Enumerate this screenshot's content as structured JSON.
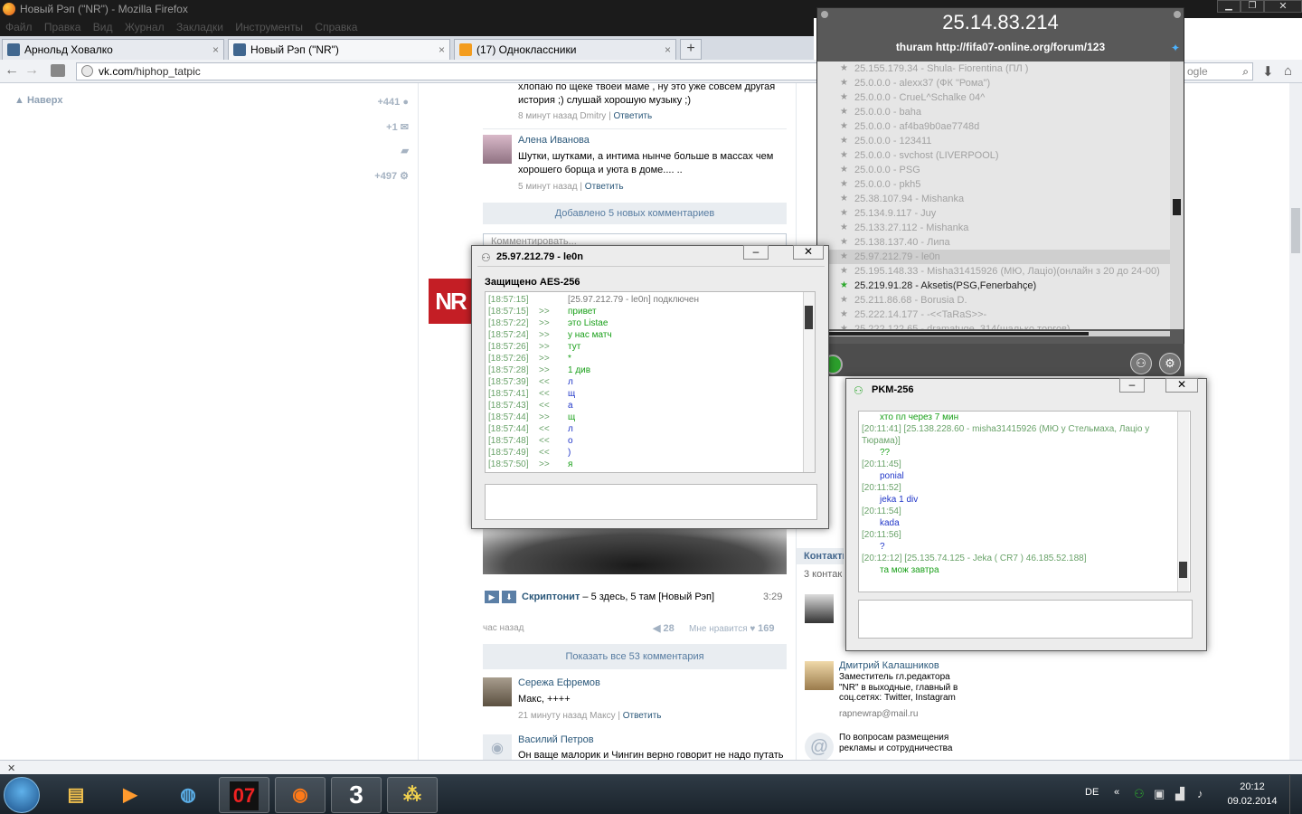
{
  "browser": {
    "window_title": "Новый Рэп (\"NR\") - Mozilla Firefox",
    "menu": [
      "Файл",
      "Правка",
      "Вид",
      "Журнал",
      "Закладки",
      "Инструменты",
      "Справка"
    ],
    "tabs": [
      {
        "label": "Арнольд Ховалко"
      },
      {
        "label": "Новый Рэп (\"NR\")"
      },
      {
        "label": "(17) Одноклассники"
      }
    ],
    "url_domain": "vk.com",
    "url_path": "/hiphop_tatpic",
    "search_placeholder": "ogle"
  },
  "vk": {
    "up_link": "Наверх",
    "counters": [
      "+441",
      "+1",
      "+497"
    ],
    "comments_top": [
      {
        "text": "хлопаю по щеке твоеи маме , ну это уже совсем другая история ;) слушай хорошую музыку ;)",
        "meta": "8 минут назад Dmitry",
        "reply": "Ответить"
      },
      {
        "author": "Алена Иванова",
        "text": "Шутки, шутками, а интима нынче больше в массах чем хорошего борща и уюта в доме.... ..",
        "meta": "5 минут назад",
        "reply": "Ответить"
      }
    ],
    "added_bar": "Добавлено 5 новых комментариев",
    "comment_placeholder": "Комментировать...",
    "track_artist": "Скриптонит",
    "track_title": " – 5 здесь, 5 там [Новый Рэп]",
    "track_time": "3:29",
    "post_time": "час назад",
    "shares": "28",
    "like_label": "Мне нравится",
    "likes": "169",
    "show_all": "Показать все 53 комментария",
    "comments_bottom": [
      {
        "author": "Сережа Ефремов",
        "text": "Макс, ++++",
        "meta": "21 минуту назад Максу",
        "reply": "Ответить"
      },
      {
        "author": "Василий Петров",
        "text": "Он ваще малорик и Чингин верно говорит не надо путать"
      }
    ]
  },
  "right": {
    "contacts_title": "Контакты",
    "contacts_count": "3 контак",
    "contact_name": "Дмитрий Калашников",
    "contact_desc": "Заместитель гл.редактора \"NR\" в выходные, главный в соц.сетях: Twitter, Instagram",
    "email": "rapnewrap@mail.ru",
    "ads_text": "По вопросам размещения рекламы и сотрудничества"
  },
  "hamachi": {
    "ip": "25.14.83.214",
    "nick": "thuram http://fifa07-online.org/forum/123",
    "peers": [
      {
        "text": "25.155.179.34 - Shula- Fiorentina (ПЛ )",
        "state": "off"
      },
      {
        "text": "25.0.0.0 - alexx37 (ФК \"Рома\")",
        "state": "off"
      },
      {
        "text": "25.0.0.0 - CrueL^Schalke 04^",
        "state": "off"
      },
      {
        "text": "25.0.0.0 - baha",
        "state": "off"
      },
      {
        "text": "25.0.0.0 - af4ba9b0ae7748d",
        "state": "off"
      },
      {
        "text": "25.0.0.0 - 123411",
        "state": "off"
      },
      {
        "text": "25.0.0.0 - svchost (LIVERPOOL)",
        "state": "off"
      },
      {
        "text": "25.0.0.0 - PSG",
        "state": "off"
      },
      {
        "text": "25.0.0.0 - pkh5",
        "state": "off"
      },
      {
        "text": "25.38.107.94 - Mishanka",
        "state": "off"
      },
      {
        "text": "25.134.9.117 - Juy",
        "state": "off"
      },
      {
        "text": "25.133.27.112 - Mishanka",
        "state": "off"
      },
      {
        "text": "25.138.137.40 - Липа",
        "state": "off"
      },
      {
        "text": "25.97.212.79 - le0n",
        "state": "sel"
      },
      {
        "text": "25.195.148.33 - Misha31415926 (МЮ, Лацio)(онлайн з 20 до 24-00)",
        "state": "off"
      },
      {
        "text": "25.219.91.28 - Aksetis(PSG,Fenerbahçe)",
        "state": "on"
      },
      {
        "text": "25.211.86.68 - Borusia D.",
        "state": "off"
      },
      {
        "text": "25.222.14.177 - -<<TaRaS>>-",
        "state": "off"
      },
      {
        "text": "25.222.122.65 - dramatuge_314(шалько торгов)",
        "state": "off"
      }
    ]
  },
  "chat1": {
    "title": "25.97.212.79 - le0n",
    "security": "Защищено AES-256",
    "lines": [
      {
        "t": "[18:57:15]",
        "d": "",
        "m": "[25.97.212.79 - le0n] подключен",
        "k": "sys"
      },
      {
        "t": "[18:57:15]",
        "d": ">>",
        "m": "привет",
        "k": "out"
      },
      {
        "t": "[18:57:22]",
        "d": ">>",
        "m": "это Listae",
        "k": "out"
      },
      {
        "t": "[18:57:24]",
        "d": ">>",
        "m": "у нас матч",
        "k": "out"
      },
      {
        "t": "[18:57:26]",
        "d": ">>",
        "m": "тут",
        "k": "out"
      },
      {
        "t": "[18:57:26]",
        "d": ">>",
        "m": "*",
        "k": "out"
      },
      {
        "t": "[18:57:28]",
        "d": ">>",
        "m": "1 див",
        "k": "out"
      },
      {
        "t": "[18:57:39]",
        "d": "<<",
        "m": "л",
        "k": "in"
      },
      {
        "t": "[18:57:41]",
        "d": "<<",
        "m": "щ",
        "k": "in"
      },
      {
        "t": "[18:57:43]",
        "d": "<<",
        "m": "а",
        "k": "in"
      },
      {
        "t": "[18:57:44]",
        "d": ">>",
        "m": "щ",
        "k": "out"
      },
      {
        "t": "[18:57:44]",
        "d": "<<",
        "m": "л",
        "k": "in"
      },
      {
        "t": "[18:57:48]",
        "d": "<<",
        "m": "о",
        "k": "in"
      },
      {
        "t": "[18:57:49]",
        "d": "<<",
        "m": ")",
        "k": "in"
      },
      {
        "t": "[18:57:50]",
        "d": ">>",
        "m": "я",
        "k": "out"
      }
    ]
  },
  "chat2": {
    "title": "PKM-256",
    "lines": [
      {
        "t": "",
        "m": "хто пл через 7 мин",
        "k": "out"
      },
      {
        "t": "[20:11:41]",
        "m": "[25.138.228.60 - misha31415926 (МЮ у Стельмаха, Лацio у Тюрама)]",
        "k": "sys"
      },
      {
        "t": "",
        "m": "??",
        "k": "out"
      },
      {
        "t": "[20:11:45]",
        "m": "",
        "k": "sys"
      },
      {
        "t": "",
        "m": "ponial",
        "k": "in"
      },
      {
        "t": "[20:11:52]",
        "m": "",
        "k": "sys"
      },
      {
        "t": "",
        "m": "jeka 1 div",
        "k": "in"
      },
      {
        "t": "[20:11:54]",
        "m": "",
        "k": "sys"
      },
      {
        "t": "",
        "m": "kada",
        "k": "in"
      },
      {
        "t": "[20:11:56]",
        "m": "",
        "k": "sys"
      },
      {
        "t": "",
        "m": "?",
        "k": "in"
      },
      {
        "t": "[20:12:12]",
        "m": "[25.135.74.125 - Jeka ( CR7 ) 46.185.52.188]",
        "k": "sys"
      },
      {
        "t": "",
        "m": "та мож завтра",
        "k": "out"
      }
    ]
  },
  "taskbar": {
    "app07": "07",
    "app3": "3",
    "lang": "DE",
    "time": "20:12",
    "date": "09.02.2014"
  },
  "colors": {
    "green_out": "#1aa01a",
    "blue_in": "#2036c8",
    "ts": "#6aa36a"
  }
}
